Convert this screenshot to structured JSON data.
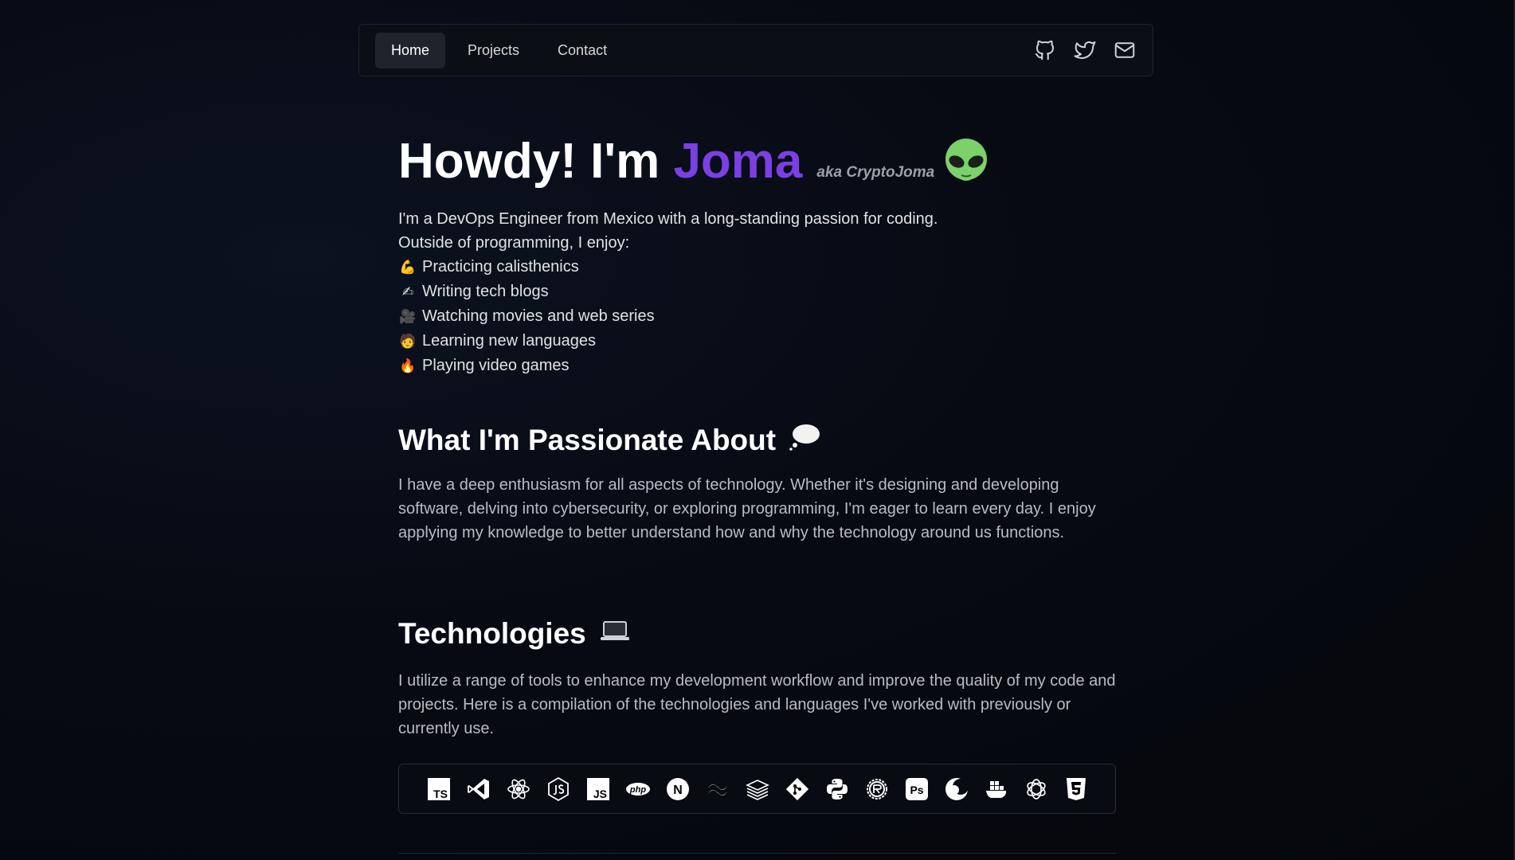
{
  "nav": {
    "links": [
      {
        "label": "Home",
        "active": true
      },
      {
        "label": "Projects",
        "active": false
      },
      {
        "label": "Contact",
        "active": false
      }
    ],
    "icons": [
      "github-icon",
      "twitter-icon",
      "mail-icon"
    ]
  },
  "hero": {
    "greeting": "Howdy! I'm",
    "name": "Joma",
    "aka": "aka CryptoJoma",
    "emoji": "alien-icon"
  },
  "intro": {
    "line1": "I'm a DevOps Engineer from Mexico with a long-standing passion for coding.",
    "line2": "Outside of programming, I enjoy:",
    "hobbies": [
      {
        "emoji": "💪",
        "text": "Practicing calisthenics"
      },
      {
        "emoji": "✍",
        "text": "Writing tech blogs"
      },
      {
        "emoji": "🎥",
        "text": "Watching movies and web series"
      },
      {
        "emoji": "🧑",
        "text": "Learning new languages"
      },
      {
        "emoji": "🔥",
        "text": "Playing video games"
      }
    ]
  },
  "passion": {
    "title": "What I'm Passionate About",
    "icon": "thought-bubble-icon",
    "text": "I have a deep enthusiasm for all aspects of technology. Whether it's designing and developing software, delving into cybersecurity, or exploring programming, I'm eager to learn every day. I enjoy applying my knowledge to better understand how and why the technology around us functions."
  },
  "technologies": {
    "title": "Technologies",
    "icon": "laptop-icon",
    "text": "I utilize a range of tools to enhance my development workflow and improve the quality of my code and projects. Here is a compilation of the technologies and languages I've worked with previously or currently use.",
    "items": [
      "typescript-icon",
      "vscode-icon",
      "react-icon",
      "nodejs-icon",
      "javascript-icon",
      "php-icon",
      "nextjs-icon",
      "tailwind-icon",
      "stack-icon",
      "git-icon",
      "python-icon",
      "rust-icon",
      "photoshop-icon",
      "eclipse-icon",
      "docker-icon",
      "openai-icon",
      "css3-icon"
    ],
    "labels": {
      "ts": "TS",
      "js": "JS",
      "php": "php",
      "ps": "Ps",
      "n": "N"
    }
  },
  "colors": {
    "accent": "#7b3fe4",
    "background": "#05070c"
  }
}
